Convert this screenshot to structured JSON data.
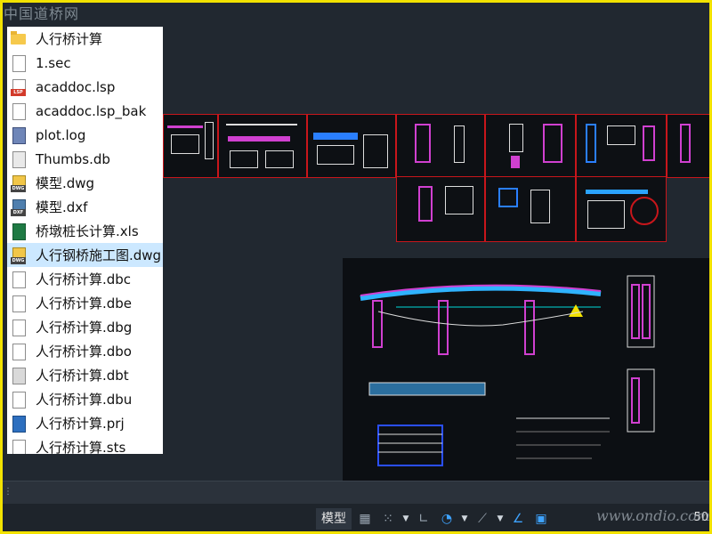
{
  "watermark": {
    "top": "中国道桥网",
    "bottom_right": "www.ondio.com"
  },
  "file_list": [
    {
      "name": "人行桥计算",
      "icon": "folder-icon",
      "selected": false
    },
    {
      "name": "1.sec",
      "icon": "blank-file-icon",
      "selected": false
    },
    {
      "name": "acaddoc.lsp",
      "icon": "lsp-file-icon",
      "selected": false
    },
    {
      "name": "acaddoc.lsp_bak",
      "icon": "blank-file-icon",
      "selected": false
    },
    {
      "name": "plot.log",
      "icon": "log-file-icon",
      "selected": false
    },
    {
      "name": "Thumbs.db",
      "icon": "thumbs-db-icon",
      "selected": false
    },
    {
      "name": "模型.dwg",
      "icon": "dwg-file-icon",
      "selected": false
    },
    {
      "name": "模型.dxf",
      "icon": "dxf-file-icon",
      "selected": false
    },
    {
      "name": "桥墩桩长计算.xls",
      "icon": "excel-file-icon",
      "selected": false
    },
    {
      "name": "人行钢桥施工图.dwg",
      "icon": "dwg-file-icon",
      "selected": true
    },
    {
      "name": "人行桥计算.dbc",
      "icon": "blank-file-icon",
      "selected": false
    },
    {
      "name": "人行桥计算.dbe",
      "icon": "blank-file-icon",
      "selected": false
    },
    {
      "name": "人行桥计算.dbg",
      "icon": "blank-file-icon",
      "selected": false
    },
    {
      "name": "人行桥计算.dbo",
      "icon": "blank-file-icon",
      "selected": false
    },
    {
      "name": "人行桥计算.dbt",
      "icon": "dbt-file-icon",
      "selected": false
    },
    {
      "name": "人行桥计算.dbu",
      "icon": "blank-file-icon",
      "selected": false
    },
    {
      "name": "人行桥计算.prj",
      "icon": "prj-file-icon",
      "selected": false
    },
    {
      "name": "人行桥计算.sts",
      "icon": "blank-file-icon",
      "selected": false
    }
  ],
  "statusbar": {
    "model_tab": "模型",
    "scale": "50"
  },
  "colors": {
    "frame": "#f2e200",
    "sheet_border": "#c8161b",
    "selection": "#cce8ff",
    "canvas": "#212830",
    "accent": "#3ea3ff"
  }
}
